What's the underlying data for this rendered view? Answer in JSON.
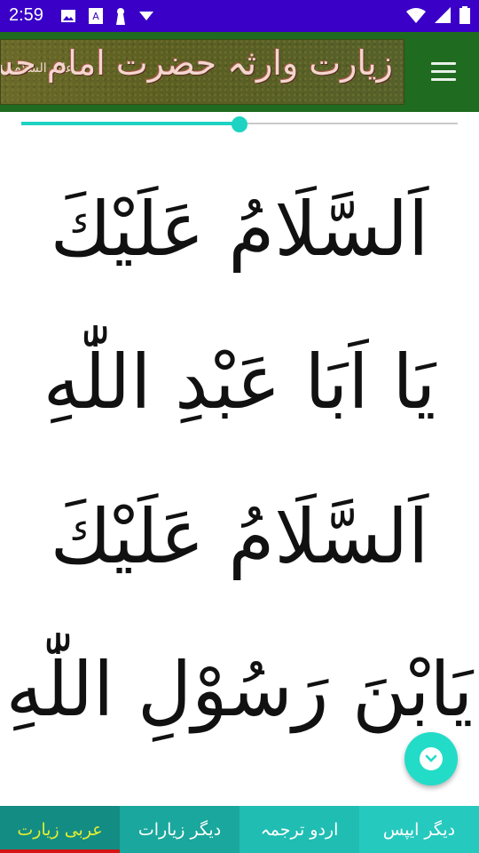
{
  "status_bar": {
    "time": "2:59",
    "background": "#3a00c8"
  },
  "app_bar": {
    "banner_title": "زیارت وارثہ حضرت امام حسین",
    "banner_subtitle": "علیہ السلام",
    "background": "#1f6b1f"
  },
  "text_size_slider": {
    "value_fraction": 0.5
  },
  "verses": [
    "اَلسَّلَامُ عَلَيْكَ",
    "يَا اَبَا عَبْدِ اللّٰهِ",
    "اَلسَّلَامُ عَلَيْكَ",
    "يَابْنَ رَسُوْلِ اللّٰهِ"
  ],
  "bottom_nav": {
    "tabs": [
      {
        "label": "عربی زیارت",
        "active": true
      },
      {
        "label": "دیگر زیارات",
        "active": false
      },
      {
        "label": "اردو ترجمہ",
        "active": false
      },
      {
        "label": "دیگر ایپس",
        "active": false
      }
    ]
  },
  "colors": {
    "accent": "#1fd3c3",
    "active_tab_text": "#e4ee30",
    "active_indicator": "#d41616"
  }
}
